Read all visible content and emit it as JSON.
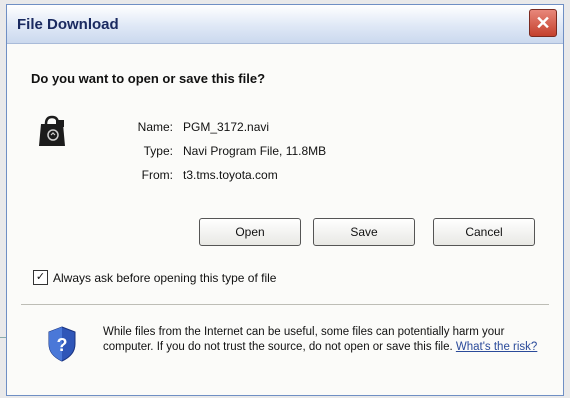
{
  "window": {
    "title": "File Download",
    "close_glyph": "✕"
  },
  "prompt": {
    "question": "Do you want to open or save this file?"
  },
  "file": {
    "icon": "file-download-icon",
    "name_label": "Name:",
    "name_value": "PGM_3172.navi",
    "type_label": "Type:",
    "type_value": "Navi Program File, 11.8MB",
    "from_label": "From:",
    "from_value": "t3.tms.toyota.com"
  },
  "buttons": {
    "open": "Open",
    "save": "Save",
    "cancel": "Cancel"
  },
  "checkbox": {
    "checked": true,
    "mark": "✓",
    "label": "Always ask before opening this type of file"
  },
  "warning": {
    "icon": "shield-question-icon",
    "text": "While files from the Internet can be useful, some files can potentially harm your computer. If you do not trust the source, do not open or save this file.",
    "link": "What's the risk?"
  },
  "colors": {
    "title": "#1a2a60",
    "close": "#c4402c",
    "link": "#2a4a9a"
  }
}
